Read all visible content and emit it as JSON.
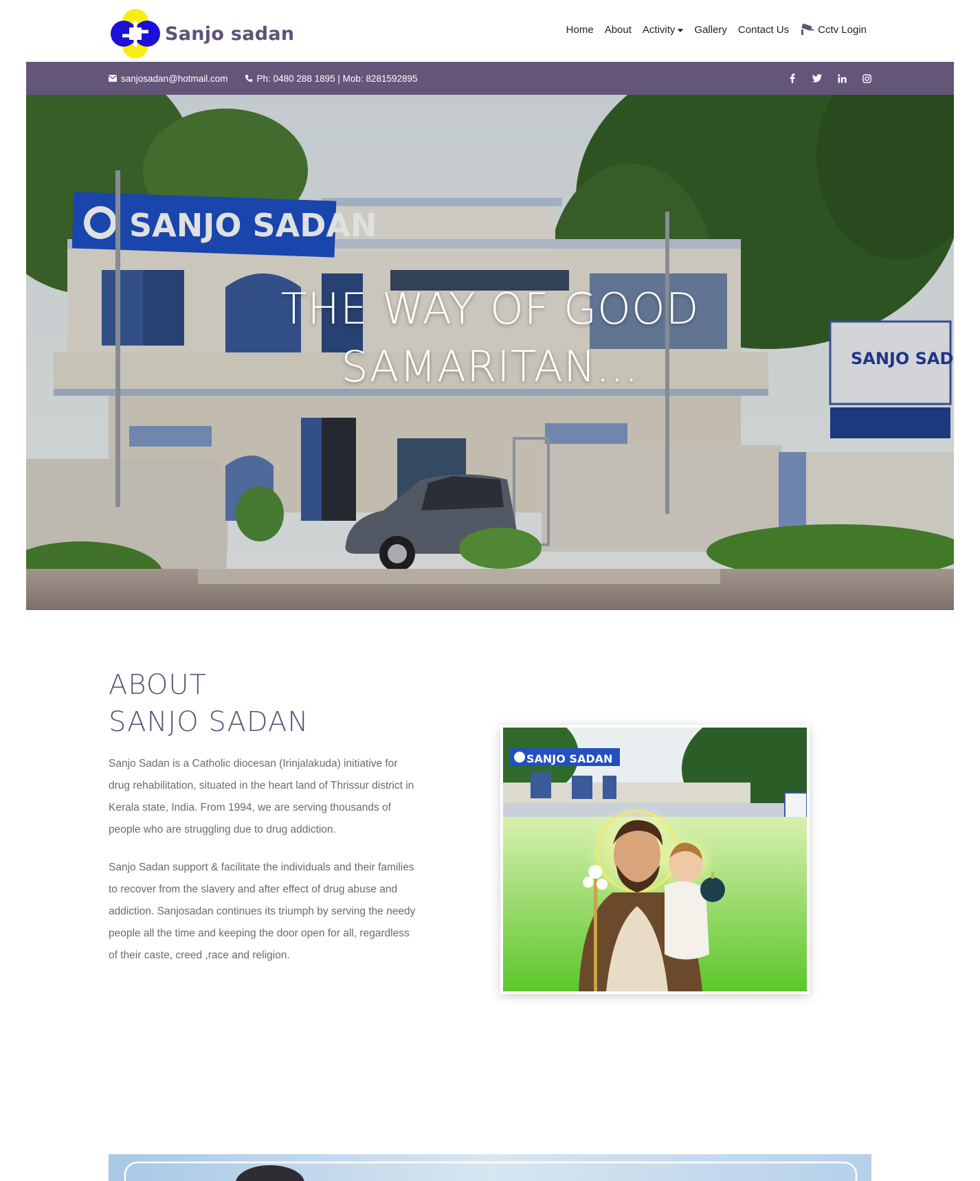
{
  "header": {
    "brand": "Sanjo sadan",
    "nav": [
      {
        "label": "Home"
      },
      {
        "label": "About"
      },
      {
        "label": "Activity"
      },
      {
        "label": "Gallery"
      },
      {
        "label": "Contact Us"
      },
      {
        "label": "Cctv Login"
      }
    ]
  },
  "topbar": {
    "email": "sanjosadan@hotmail.com",
    "phone": "Ph: 0480 288 1895 | Mob: 8281592895",
    "social": [
      "f",
      "t",
      "in",
      "ig"
    ]
  },
  "hero": {
    "title_line1": "THE WAY OF GOOD",
    "title_line2": "SAMARITAN...",
    "sign_main": "SANJO SADAN",
    "sign_side": "SANJO SADAN"
  },
  "about": {
    "heading_line1": "ABOUT",
    "heading_line2": "SANJO SADAN",
    "paragraph1": "Sanjo Sadan is a Catholic diocesan (Irinjalakuda) initiative for drug rehabilitation, situated in the heart land of Thrissur district in Kerala state, India. From 1994, we are serving thousands of people who are struggling due to drug addiction.",
    "paragraph2": "Sanjo Sadan support & facilitate the individuals and their families to recover from the slavery and after effect of drug abuse and addiction. Sanjosadan continues its triumph by serving the needy people all the time and keeping the door open for all, regardless of their caste, creed ,race and religion.",
    "photo_sign": "SANJO SADAN"
  },
  "colors": {
    "brand_purple": "#5f5178",
    "topbar_bg": "#645678",
    "logo_blue": "#1a10d8",
    "logo_yellow": "#f5ee10"
  }
}
